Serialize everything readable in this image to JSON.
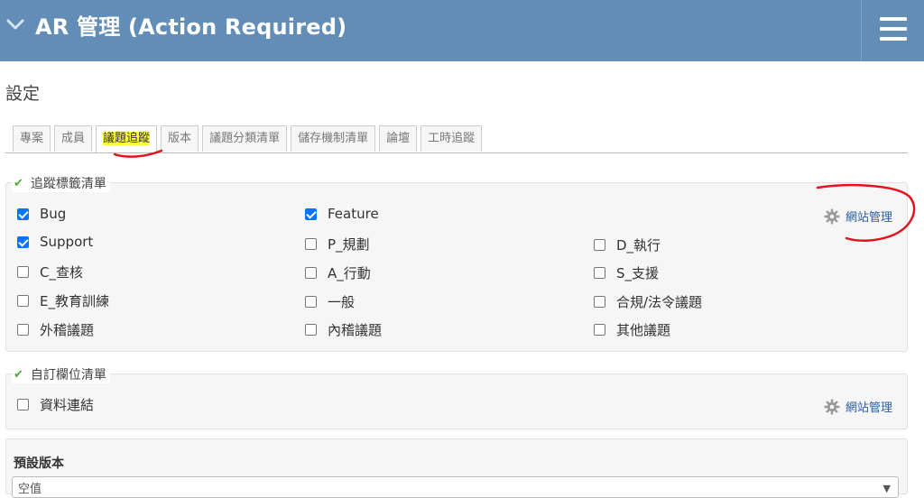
{
  "header": {
    "title": "AR 管理 (Action Required)",
    "menu_icon": "hamburger-menu-icon",
    "collapse_icon": "chevron-down-icon",
    "background": "#628db6"
  },
  "page": {
    "title": "設定"
  },
  "tabs": [
    {
      "label": "專案",
      "selected": false
    },
    {
      "label": "成員",
      "selected": false
    },
    {
      "label": "議題追蹤",
      "selected": true
    },
    {
      "label": "版本",
      "selected": false
    },
    {
      "label": "議題分類清單",
      "selected": false
    },
    {
      "label": "儲存機制清單",
      "selected": false
    },
    {
      "label": "論壇",
      "selected": false
    },
    {
      "label": "工時追蹤",
      "selected": false
    }
  ],
  "trackers": {
    "legend": "追蹤標籤清單",
    "site_admin_label": "網站管理",
    "items": [
      {
        "label": "Bug",
        "checked": true
      },
      {
        "label": "Feature",
        "checked": true
      },
      {
        "label": "Support",
        "checked": true
      },
      {
        "label": "P_規劃",
        "checked": false
      },
      {
        "label": "D_執行",
        "checked": false
      },
      {
        "label": "C_查核",
        "checked": false
      },
      {
        "label": "A_行動",
        "checked": false
      },
      {
        "label": "S_支援",
        "checked": false
      },
      {
        "label": "E_教育訓練",
        "checked": false
      },
      {
        "label": "一般",
        "checked": false
      },
      {
        "label": "合規/法令議題",
        "checked": false
      },
      {
        "label": "外稽議題",
        "checked": false
      },
      {
        "label": "內稽議題",
        "checked": false
      },
      {
        "label": "其他議題",
        "checked": false
      }
    ]
  },
  "custom_fields": {
    "legend": "自訂欄位清單",
    "site_admin_label": "網站管理",
    "items": [
      {
        "label": "資料連結",
        "checked": false
      }
    ]
  },
  "default_version": {
    "label": "預設版本",
    "selected_value": "空值"
  },
  "accent_color": "#2a5d9f",
  "annotation_color": "#e0141e"
}
